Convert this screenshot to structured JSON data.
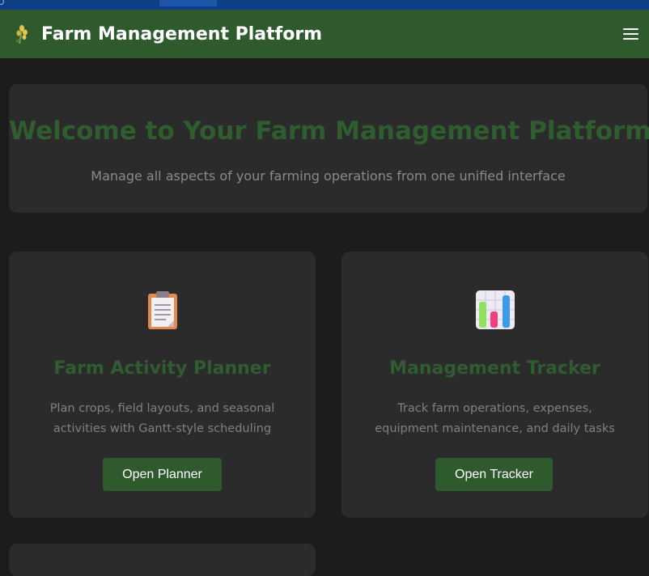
{
  "header": {
    "title": "Farm Management Platform",
    "logo_icon": "wheat-icon",
    "menu_icon": "hamburger-menu-icon"
  },
  "hero": {
    "heading": "Welcome to Your Farm Management Platform",
    "subtitle": "Manage all aspects of your farming operations from one unified interface"
  },
  "cards": [
    {
      "icon": "clipboard-icon",
      "title": "Farm Activity Planner",
      "description": "Plan crops, field layouts, and seasonal activities with Gantt-style scheduling",
      "button_label": "Open Planner"
    },
    {
      "icon": "bar-chart-icon",
      "title": "Management Tracker",
      "description": "Track farm operations, expenses, equipment maintenance, and daily tasks",
      "button_label": "Open Tracker"
    }
  ],
  "colors": {
    "header_bg": "#2e5a2e",
    "page_bg": "#1c1c1c",
    "card_bg": "#2b2b2b",
    "accent_text": "#2f5d2f",
    "top_strip": "#0f3f86"
  }
}
